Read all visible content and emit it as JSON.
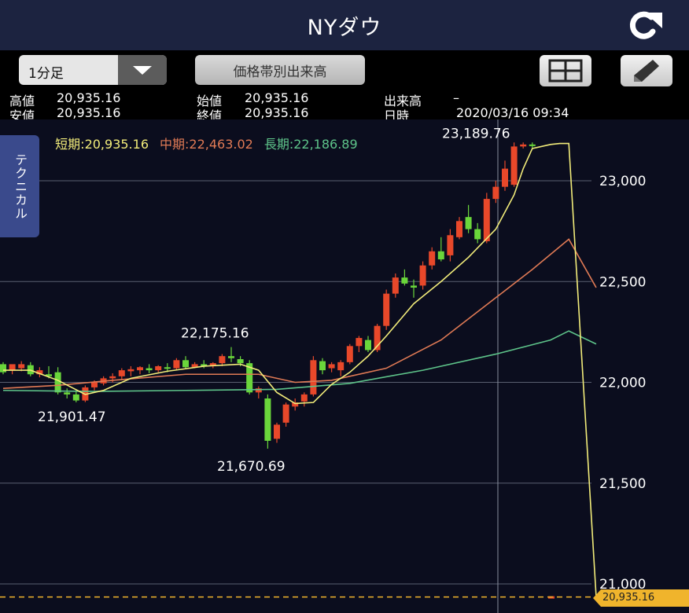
{
  "header": {
    "title": "NYダウ",
    "refresh_icon": "refresh-icon"
  },
  "toolbar": {
    "period": "1分足",
    "volume_button": "価格帯別出来高",
    "layout_icon": "grid-layout-icon",
    "draw_icon": "pencil-icon"
  },
  "info": {
    "high_label": "高値",
    "high_value": "20,935.16",
    "open_label": "始値",
    "open_value": "20,935.16",
    "volume_label": "出来高",
    "volume_value": "–",
    "low_label": "安値",
    "low_value": "20,935.16",
    "close_label": "終値",
    "close_value": "20,935.16",
    "date_label": "日時",
    "date_value": "2020/03/16 09:34"
  },
  "legend": {
    "short": "短期:20,935.16",
    "mid": "中期:22,463.02",
    "long": "長期:22,186.89"
  },
  "side_tab": {
    "label": "テクニカル"
  },
  "colors": {
    "up": "#e8482a",
    "down": "#6ad63b",
    "short_ma": "#f2ec7a",
    "mid_ma": "#e07a55",
    "long_ma": "#5ec48a",
    "background": "#0b0d1e",
    "grid": "#5a5f70"
  },
  "chart_data": {
    "type": "candlestick",
    "y_ticks": [
      "23,000",
      "22,500",
      "22,000",
      "21,500",
      "21,000"
    ],
    "y_tick_values": [
      23000,
      22500,
      22000,
      21500,
      21000
    ],
    "ylim": [
      20900,
      23400
    ],
    "annotations": [
      {
        "text": "23,189.76",
        "value": 23189.76
      },
      {
        "text": "22,175.16",
        "value": 22175.16
      },
      {
        "text": "21,901.47",
        "value": 21901.47
      },
      {
        "text": "21,670.69",
        "value": 21670.69
      }
    ],
    "last_price_label": "20,935.16",
    "last_price": 20935.16,
    "candles": [
      [
        22090,
        22100,
        22050,
        22040
      ],
      [
        22060,
        22080,
        22090,
        22040
      ],
      [
        22070,
        22105,
        22090,
        22055
      ],
      [
        22085,
        22100,
        22040,
        22030
      ],
      [
        22040,
        22075,
        22060,
        22025
      ],
      [
        22040,
        22080,
        22030,
        22020
      ],
      [
        22050,
        22075,
        21950,
        21940
      ],
      [
        21950,
        21970,
        21940,
        21920
      ],
      [
        21940,
        21960,
        21910,
        21901
      ],
      [
        21910,
        21985,
        21975,
        21902
      ],
      [
        21975,
        22010,
        22000,
        21960
      ],
      [
        21995,
        22030,
        22020,
        21985
      ],
      [
        22020,
        22045,
        22030,
        22000
      ],
      [
        22030,
        22070,
        22060,
        22010
      ],
      [
        22055,
        22080,
        22065,
        22030
      ],
      [
        22060,
        22080,
        22075,
        22040
      ],
      [
        22070,
        22090,
        22060,
        22045
      ],
      [
        22060,
        22085,
        22080,
        22050
      ],
      [
        22075,
        22095,
        22070,
        22050
      ],
      [
        22070,
        22120,
        22110,
        22060
      ],
      [
        22110,
        22130,
        22075,
        22065
      ],
      [
        22075,
        22100,
        22090,
        22070
      ],
      [
        22090,
        22110,
        22080,
        22070
      ],
      [
        22080,
        22100,
        22095,
        22070
      ],
      [
        22095,
        22140,
        22130,
        22080
      ],
      [
        22130,
        22175,
        22120,
        22100
      ],
      [
        22115,
        22130,
        22095,
        22080
      ],
      [
        22095,
        22110,
        21950,
        21940
      ],
      [
        21950,
        21980,
        21970,
        21920
      ],
      [
        21920,
        21940,
        21710,
        21671
      ],
      [
        21720,
        21800,
        21790,
        21700
      ],
      [
        21800,
        21900,
        21890,
        21780
      ],
      [
        21880,
        21920,
        21900,
        21860
      ],
      [
        21905,
        21950,
        21940,
        21880
      ],
      [
        21940,
        22130,
        22110,
        21930
      ],
      [
        22105,
        22120,
        22060,
        22040
      ],
      [
        22070,
        22100,
        22090,
        22050
      ],
      [
        22060,
        22110,
        22100,
        22030
      ],
      [
        22100,
        22190,
        22180,
        22090
      ],
      [
        22180,
        22230,
        22220,
        22150
      ],
      [
        22210,
        22230,
        22160,
        22150
      ],
      [
        22160,
        22290,
        22280,
        22150
      ],
      [
        22280,
        22460,
        22440,
        22260
      ],
      [
        22440,
        22540,
        22520,
        22420
      ],
      [
        22520,
        22560,
        22490,
        22480
      ],
      [
        22480,
        22510,
        22470,
        22420
      ],
      [
        22480,
        22600,
        22580,
        22460
      ],
      [
        22580,
        22670,
        22650,
        22560
      ],
      [
        22650,
        22720,
        22610,
        22600
      ],
      [
        22630,
        22760,
        22730,
        22600
      ],
      [
        22720,
        22820,
        22800,
        22710
      ],
      [
        22820,
        22880,
        22760,
        22740
      ],
      [
        22760,
        22790,
        22710,
        22690
      ],
      [
        22700,
        22940,
        22910,
        22690
      ],
      [
        22910,
        23000,
        22970,
        22890
      ],
      [
        22970,
        23100,
        23060,
        22950
      ],
      [
        22980,
        23190,
        23170,
        22970
      ],
      [
        23170,
        23190,
        23180,
        23160
      ],
      [
        23180,
        23190,
        23175,
        23160
      ]
    ],
    "short_ma": [
      [
        0,
        22060
      ],
      [
        3,
        22060
      ],
      [
        6,
        22010
      ],
      [
        9,
        21940
      ],
      [
        11,
        21960
      ],
      [
        14,
        22020
      ],
      [
        18,
        22055
      ],
      [
        22,
        22080
      ],
      [
        26,
        22090
      ],
      [
        28,
        22060
      ],
      [
        30,
        21950
      ],
      [
        32,
        21895
      ],
      [
        34,
        21900
      ],
      [
        36,
        21990
      ],
      [
        38,
        22050
      ],
      [
        40,
        22130
      ],
      [
        42,
        22230
      ],
      [
        45,
        22390
      ],
      [
        48,
        22500
      ],
      [
        51,
        22620
      ],
      [
        54,
        22760
      ],
      [
        56,
        22930
      ],
      [
        57,
        23060
      ],
      [
        58,
        23160
      ],
      [
        60,
        23180
      ],
      [
        61,
        23185
      ],
      [
        62,
        23185
      ],
      [
        65,
        20935
      ]
    ],
    "mid_ma": [
      [
        0,
        21970
      ],
      [
        6,
        21985
      ],
      [
        12,
        22010
      ],
      [
        20,
        22040
      ],
      [
        28,
        22040
      ],
      [
        32,
        22000
      ],
      [
        36,
        22010
      ],
      [
        42,
        22070
      ],
      [
        48,
        22210
      ],
      [
        54,
        22420
      ],
      [
        58,
        22560
      ],
      [
        62,
        22710
      ],
      [
        65,
        22470
      ]
    ],
    "long_ma": [
      [
        0,
        21960
      ],
      [
        10,
        21955
      ],
      [
        20,
        21960
      ],
      [
        30,
        21965
      ],
      [
        38,
        21995
      ],
      [
        46,
        22060
      ],
      [
        54,
        22140
      ],
      [
        60,
        22210
      ],
      [
        62,
        22255
      ],
      [
        65,
        22190
      ]
    ]
  }
}
